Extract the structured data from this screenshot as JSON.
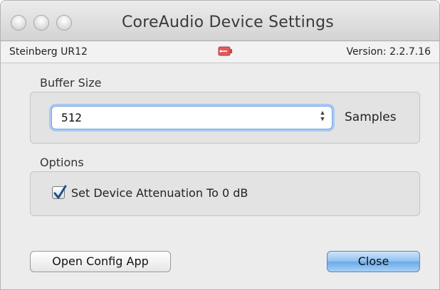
{
  "window": {
    "title": "CoreAudio Device Settings"
  },
  "info": {
    "device_name": "Steinberg UR12",
    "version": "Version: 2.2.7.16",
    "device_icon": "usb-icon"
  },
  "buffer": {
    "section_label": "Buffer Size",
    "selected_value": "512",
    "unit": "Samples"
  },
  "options": {
    "section_label": "Options",
    "attenuation_label": "Set Device Attenuation To 0 dB",
    "attenuation_checked": true
  },
  "buttons": {
    "open_config": "Open Config App",
    "close": "Close"
  },
  "colors": {
    "default_button": "#6aa9ea",
    "focus_ring": "#a9c9f2"
  }
}
